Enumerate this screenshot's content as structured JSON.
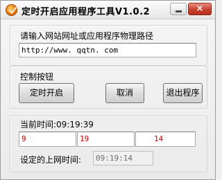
{
  "window": {
    "title": "定时开启应用程序工具V1.0.2",
    "close_label": "×"
  },
  "url_section": {
    "label": "请输入网站网址或应用程序物理路径",
    "value": "http://www. qqtn. com"
  },
  "control_section": {
    "label": "控制按钮",
    "start_button": "定时开启",
    "cancel_button": "取消",
    "exit_button": "退出程序"
  },
  "time_section": {
    "current_time_label": "当前时间:09:19:39",
    "hour_value": "9",
    "minute_value": "19",
    "second_value": "14",
    "set_time_label": "设定的上网时间:",
    "set_time_value": "09:19:14"
  },
  "colors": {
    "accent_red": "#c00000",
    "close_button": "#c8412f"
  }
}
